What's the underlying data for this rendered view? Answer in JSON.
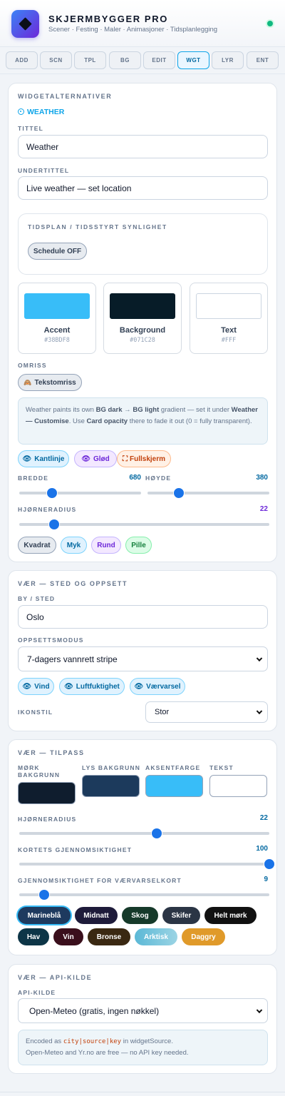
{
  "app": {
    "title": "SKJERMBYGGER PRO",
    "subtitle": "Scener · Festing · Maler · Animasjoner · Tidsplanlegging"
  },
  "tabs": [
    "ADD",
    "SCN",
    "TPL",
    "BG",
    "EDIT",
    "WGT",
    "LYR",
    "ENT"
  ],
  "active_tab": "WGT",
  "widget_options": {
    "section_title": "WIDGETALTERNATIVER",
    "widget_type": "WEATHER",
    "title_label": "TITTEL",
    "title_value": "Weather",
    "subtitle_label": "UNDERTITTEL",
    "subtitle_value": "Live weather — set location",
    "schedule_title": "TIDSPLAN / TIDSSTYRT SYNLIGHET",
    "schedule_button": "Schedule OFF",
    "swatches": [
      {
        "name": "Accent",
        "hex": "#38BDF8",
        "color": "#38BDF8"
      },
      {
        "name": "Background",
        "hex": "#071C28",
        "color": "#071C28"
      },
      {
        "name": "Text",
        "hex": "#FFF",
        "color": "#FFFFFF"
      }
    ],
    "outline_label": "OMRISS",
    "outline_button": "Tekstomriss",
    "note": {
      "t1": "Weather paints its own ",
      "b1": "BG dark",
      "t2": " → ",
      "b2": "BG light",
      "t3": " gradient — set it under ",
      "b3": "Weather — Customise",
      "t4": ". Use ",
      "b4": "Card opacity",
      "t5": " there to fade it out (0 = fully transparent)."
    },
    "toggles": [
      "Kantlinje",
      "Glød",
      "Fullskjerm"
    ],
    "width_label": "BREDDE",
    "width_value": "680",
    "height_label": "HØYDE",
    "height_value": "380",
    "radius_label": "HJØRNERADIUS",
    "radius_value": "22",
    "shapes": [
      "Kvadrat",
      "Myk",
      "Rund",
      "Pille"
    ],
    "sliders": {
      "width": 0.27,
      "height": 0.26,
      "radius": 0.14
    }
  },
  "location": {
    "section_title": "VÆR — STED OG OPPSETT",
    "city_label": "BY / STED",
    "city_value": "Oslo",
    "layout_label": "OPPSETTSMODUS",
    "layout_value": "7-dagers vannrett stripe",
    "toggles": [
      "Vind",
      "Luftfuktighet",
      "Værvarsel"
    ],
    "icon_label": "IKONSTIL",
    "icon_value": "Stor"
  },
  "customise": {
    "section_title": "VÆR — TILPASS",
    "colors": [
      {
        "label": "MØRK BAKGRUNN",
        "color": "#0F1D2E"
      },
      {
        "label": "LYS BAKGRUNN",
        "color": "#1C3A5C"
      },
      {
        "label": "AKSENTFARGE",
        "color": "#38BDF8"
      },
      {
        "label": "TEKST",
        "color": "#FFFFFF"
      }
    ],
    "radius_label": "HJØRNERADIUS",
    "radius_value": "22",
    "opacity_label": "KORTETS GJENNOMSIKTIGHET",
    "opacity_value": "100",
    "forecast_label": "GJENNOMSIKTIGHET FOR VÆRVARSELKORT",
    "forecast_value": "9",
    "sliders": {
      "radius": 0.55,
      "opacity": 1.0,
      "forecast": 0.1
    },
    "themes": [
      {
        "name": "Marineblå",
        "bg": "#1e3a5f",
        "selected": true
      },
      {
        "name": "Midnatt",
        "bg": "#1e1b3a"
      },
      {
        "name": "Skog",
        "bg": "#163a2a"
      },
      {
        "name": "Skifer",
        "bg": "#2b3545"
      },
      {
        "name": "Helt mørk",
        "bg": "#111111"
      },
      {
        "name": "Hav",
        "bg": "#0d3547"
      },
      {
        "name": "Vin",
        "bg": "#3a0f1c"
      },
      {
        "name": "Bronse",
        "bg": "#3a2812"
      },
      {
        "name": "Arktisk",
        "bg": "#5bb8d6"
      },
      {
        "name": "Daggry",
        "bg": "#e09a2a"
      }
    ]
  },
  "api": {
    "section_title": "VÆR — API-KILDE",
    "source_label": "API-KILDE",
    "source_value": "Open-Meteo (gratis, ingen nøkkel)",
    "note_prefix": "Encoded as ",
    "note_code": "city|source|key",
    "note_suffix": " in widgetSource.",
    "note_line2": "Open-Meteo and Yr.no are free — no API key needed."
  },
  "colors": {
    "accent": "#0ea5e9",
    "primary": "#1a73e8",
    "ok": "#10b981"
  }
}
